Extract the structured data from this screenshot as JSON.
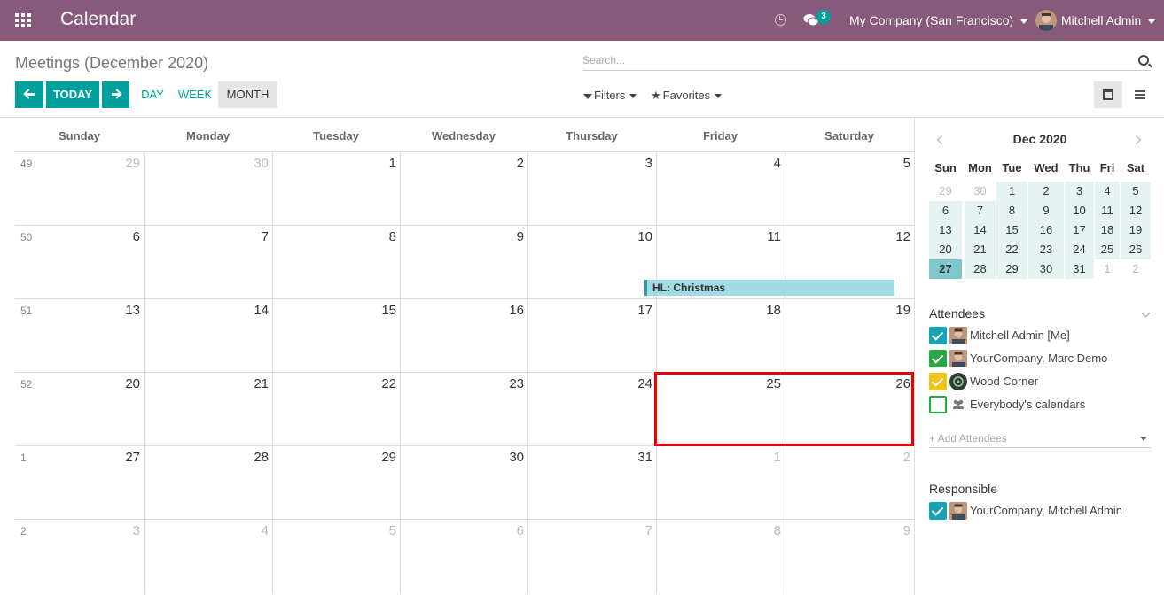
{
  "navbar": {
    "app_title": "Calendar",
    "chat_badge": "3",
    "company": "My Company (San Francisco)",
    "user": "Mitchell Admin"
  },
  "control_panel": {
    "breadcrumb": "Meetings (December 2020)",
    "search_placeholder": "Search...",
    "today_label": "TODAY",
    "scales": [
      "DAY",
      "WEEK",
      "MONTH"
    ],
    "active_scale": "MONTH",
    "filters_label": "Filters",
    "favorites_label": "Favorites"
  },
  "month": {
    "weekdays": [
      "Sunday",
      "Monday",
      "Tuesday",
      "Wednesday",
      "Thursday",
      "Friday",
      "Saturday"
    ],
    "weeks": [
      {
        "num": "49",
        "days": [
          "29",
          "30",
          "1",
          "2",
          "3",
          "4",
          "5"
        ],
        "other": [
          true,
          true,
          false,
          false,
          false,
          false,
          false
        ]
      },
      {
        "num": "50",
        "days": [
          "6",
          "7",
          "8",
          "9",
          "10",
          "11",
          "12"
        ],
        "other": [
          false,
          false,
          false,
          false,
          false,
          false,
          false
        ]
      },
      {
        "num": "51",
        "days": [
          "13",
          "14",
          "15",
          "16",
          "17",
          "18",
          "19"
        ],
        "other": [
          false,
          false,
          false,
          false,
          false,
          false,
          false
        ]
      },
      {
        "num": "52",
        "days": [
          "20",
          "21",
          "22",
          "23",
          "24",
          "25",
          "26"
        ],
        "other": [
          false,
          false,
          false,
          false,
          false,
          false,
          false
        ]
      },
      {
        "num": "1",
        "days": [
          "27",
          "28",
          "29",
          "30",
          "31",
          "1",
          "2"
        ],
        "other": [
          false,
          false,
          false,
          false,
          false,
          true,
          true
        ]
      },
      {
        "num": "2",
        "days": [
          "3",
          "4",
          "5",
          "6",
          "7",
          "8",
          "9"
        ],
        "other": [
          true,
          true,
          true,
          true,
          true,
          true,
          true
        ]
      }
    ],
    "event": "HL: Christmas"
  },
  "mini_calendar": {
    "title": "Dec 2020",
    "weekdays": [
      "Sun",
      "Mon",
      "Tue",
      "Wed",
      "Thu",
      "Fri",
      "Sat"
    ],
    "weeks": [
      [
        "29",
        "30",
        "1",
        "2",
        "3",
        "4",
        "5"
      ],
      [
        "6",
        "7",
        "8",
        "9",
        "10",
        "11",
        "12"
      ],
      [
        "13",
        "14",
        "15",
        "16",
        "17",
        "18",
        "19"
      ],
      [
        "20",
        "21",
        "22",
        "23",
        "24",
        "25",
        "26"
      ],
      [
        "27",
        "28",
        "29",
        "30",
        "31",
        "1",
        "2"
      ]
    ],
    "today": "27"
  },
  "attendees": {
    "title": "Attendees",
    "items": [
      {
        "name": "Mitchell Admin [Me]",
        "color": "#17a2b8"
      },
      {
        "name": "YourCompany, Marc Demo",
        "color": "#28a745"
      },
      {
        "name": "Wood Corner",
        "color": "#f0c419"
      },
      {
        "name": "Everybody's calendars",
        "color": "#28a745"
      }
    ],
    "add_placeholder": "+ Add Attendees"
  },
  "responsible": {
    "title": "Responsible",
    "items": [
      {
        "name": "YourCompany, Mitchell Admin",
        "color": "#17a2b8"
      }
    ]
  },
  "colors": {
    "brand": "#875a7b",
    "primary": "#00a09d",
    "event_bg": "#a0dbe3",
    "highlight": "#e60000"
  }
}
